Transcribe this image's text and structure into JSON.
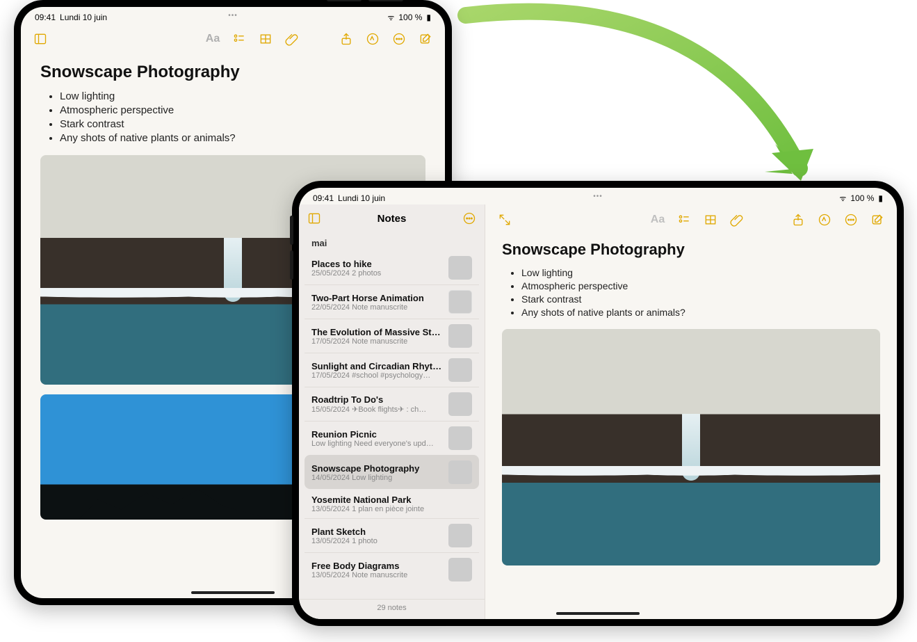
{
  "status": {
    "time": "09:41",
    "date": "Lundi 10 juin",
    "battery": "100 %",
    "wifi": "●●●"
  },
  "portrait": {
    "note_title": "Snowscape Photography",
    "bullets": [
      "Low lighting",
      "Atmospheric perspective",
      "Stark contrast",
      "Any shots of native plants or animals?"
    ]
  },
  "landscape": {
    "sidebar_title": "Notes",
    "section": "mai",
    "footer": "29 notes",
    "items": [
      {
        "title": "Places to hike",
        "date": "25/05/2024",
        "meta": "2 photos",
        "thumb": "th-green"
      },
      {
        "title": "Two-Part Horse Animation",
        "date": "22/05/2024",
        "meta": "Note manuscrite",
        "thumb": "th-white"
      },
      {
        "title": "The Evolution of Massive Star…",
        "date": "17/05/2024",
        "meta": "Note manuscrite",
        "thumb": "th-blue"
      },
      {
        "title": "Sunlight and Circadian Rhyth…",
        "date": "17/05/2024",
        "meta": "#school #psychology…",
        "thumb": "th-pink"
      },
      {
        "title": "Roadtrip To Do's",
        "date": "15/05/2024",
        "meta": "✈︎Book flights✈︎ : ch…",
        "thumb": "th-road"
      },
      {
        "title": "Reunion Picnic",
        "date": "Low lighting",
        "meta": "Need everyone's upd…",
        "thumb": "th-orange"
      },
      {
        "title": "Snowscape Photography",
        "date": "14/05/2024",
        "meta": "Low lighting",
        "thumb": "th-snow",
        "selected": true
      },
      {
        "title": "Yosemite National Park",
        "date": "13/05/2024",
        "meta": "1 plan en pièce jointe",
        "thumb": ""
      },
      {
        "title": "Plant Sketch",
        "date": "13/05/2024",
        "meta": "1 photo",
        "thumb": "th-plant"
      },
      {
        "title": "Free Body Diagrams",
        "date": "13/05/2024",
        "meta": "Note manuscrite",
        "thumb": "th-diag"
      }
    ],
    "note_title": "Snowscape Photography",
    "bullets": [
      "Low lighting",
      "Atmospheric perspective",
      "Stark contrast",
      "Any shots of native plants or animals?"
    ]
  },
  "icons": {
    "sidebar": "sidebar-toggle-icon",
    "expand": "expand-icon",
    "format": "Aa",
    "checklist": "checklist-icon",
    "table": "table-icon",
    "attach": "paperclip-icon",
    "share": "share-icon",
    "pen": "markup-icon",
    "more": "ellipsis-icon",
    "compose": "compose-icon"
  }
}
